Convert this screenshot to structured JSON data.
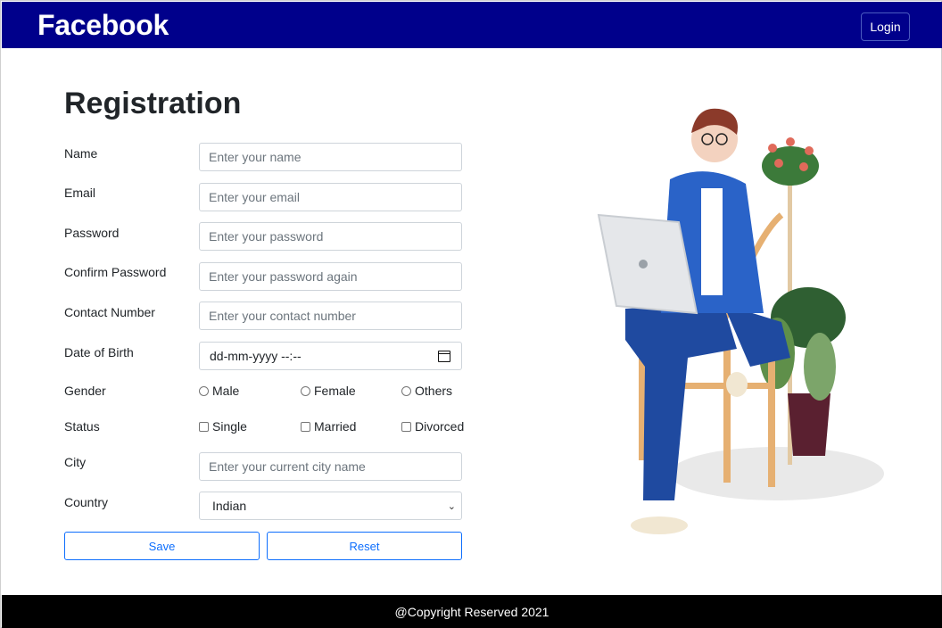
{
  "navbar": {
    "brand": "Facebook",
    "login_label": "Login"
  },
  "form": {
    "heading": "Registration",
    "name": {
      "label": "Name",
      "placeholder": "Enter your name"
    },
    "email": {
      "label": "Email",
      "placeholder": "Enter your email"
    },
    "password": {
      "label": "Password",
      "placeholder": "Enter your password"
    },
    "confirm_password": {
      "label": "Confirm Password",
      "placeholder": "Enter your password again"
    },
    "contact": {
      "label": "Contact Number",
      "placeholder": "Enter your contact number"
    },
    "dob": {
      "label": "Date of Birth",
      "placeholder": "dd-mm-yyyy --:--"
    },
    "gender": {
      "label": "Gender",
      "options": [
        "Male",
        "Female",
        "Others"
      ]
    },
    "status": {
      "label": "Status",
      "options": [
        "Single",
        "Married",
        "Divorced"
      ]
    },
    "city": {
      "label": "City",
      "placeholder": "Enter your current city name"
    },
    "country": {
      "label": "Country",
      "selected": "Indian"
    },
    "save_label": "Save",
    "reset_label": "Reset"
  },
  "footer": {
    "text": "@Copyright Reserved 2021"
  },
  "colors": {
    "navbar": "#00008b",
    "footer": "#000000",
    "primary": "#0d6efd"
  },
  "icons": {
    "calendar": "calendar-icon",
    "chevron": "chevron-down-icon"
  }
}
